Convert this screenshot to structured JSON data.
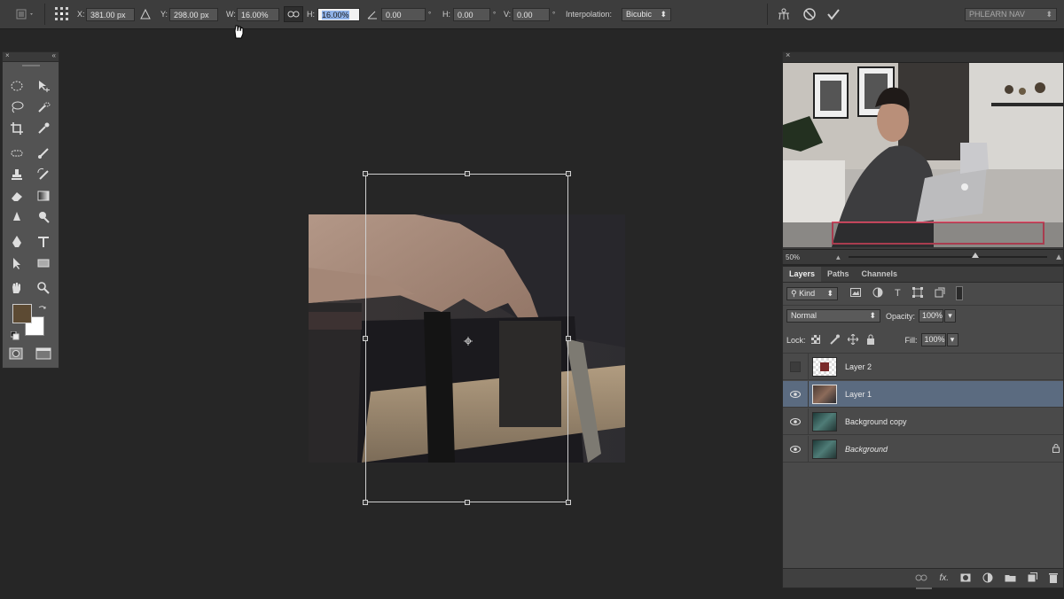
{
  "options_bar": {
    "x_label": "X:",
    "x_value": "381.00 px",
    "y_label": "Y:",
    "y_value": "298.00 px",
    "w_label": "W:",
    "w_value": "16.00%",
    "h_label": "H:",
    "h_value": "16.00%",
    "angle_value": "0.00",
    "angle_unit": "°",
    "skew_h_label": "H:",
    "skew_h_value": "0.00",
    "skew_h_unit": "°",
    "skew_v_label": "V:",
    "skew_v_value": "0.00",
    "skew_v_unit": "°",
    "interpolation_label": "Interpolation:",
    "interpolation_value": "Bicubic",
    "workspace_value": "PHLEARN NAV"
  },
  "video_panel": {
    "zoom": "50%",
    "zoom_slider_level": 0.62
  },
  "layers_panel": {
    "tabs": [
      {
        "label": "Layers"
      },
      {
        "label": "Paths"
      },
      {
        "label": "Channels"
      }
    ],
    "filter_kind": "Kind",
    "blend_mode": "Normal",
    "opacity_label": "Opacity:",
    "opacity_value": "100%",
    "lock_label": "Lock:",
    "fill_label": "Fill:",
    "fill_value": "100%",
    "layers": [
      {
        "name": "Layer 2"
      },
      {
        "name": "Layer 1"
      },
      {
        "name": "Background copy"
      },
      {
        "name": "Background"
      }
    ]
  },
  "colors": {
    "foreground": "#5c4a33",
    "background": "#ffffff",
    "selected_layer": "#5b6b80",
    "accent_red": "#e0506a"
  }
}
